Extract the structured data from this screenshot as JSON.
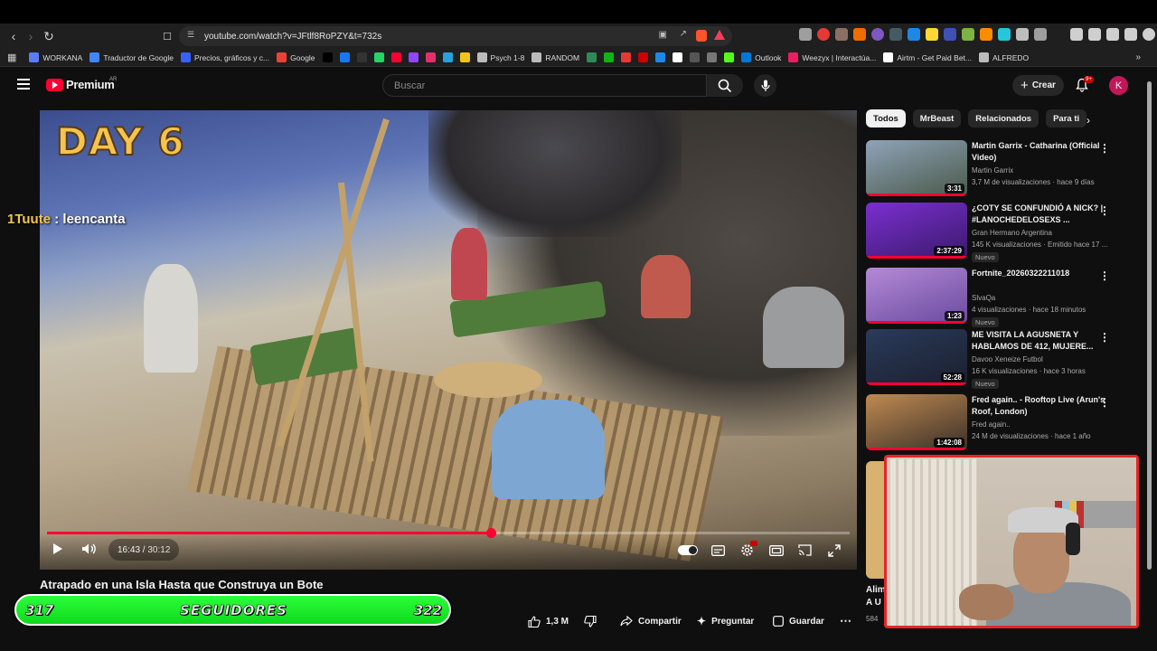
{
  "browser": {
    "url": "youtube.com/watch?v=JFtlf8RoPZY&t=732s",
    "bookmarks": [
      {
        "label": "WORKANA",
        "color": "#5b7cf5"
      },
      {
        "label": "Traductor de Google",
        "color": "#4285f4"
      },
      {
        "label": "Precios, gráficos y c...",
        "color": "#3861fb"
      },
      {
        "label": "Google",
        "color": "#ea4335"
      },
      {
        "label": "",
        "color": "#000000"
      },
      {
        "label": "",
        "color": "#1877f2"
      },
      {
        "label": "",
        "color": "#333333"
      },
      {
        "label": "",
        "color": "#25d366"
      },
      {
        "label": "",
        "color": "#ff0033"
      },
      {
        "label": "",
        "color": "#9146ff"
      },
      {
        "label": "",
        "color": "#e1306c"
      },
      {
        "label": "",
        "color": "#2aa1d8"
      },
      {
        "label": "",
        "color": "#f0c419"
      },
      {
        "label": "Psych 1-8",
        "color": "#bbbbbb"
      },
      {
        "label": "RANDOM",
        "color": "#bbbbbb"
      },
      {
        "label": "",
        "color": "#2e8b57"
      },
      {
        "label": "",
        "color": "#12b312"
      },
      {
        "label": "",
        "color": "#e53935"
      },
      {
        "label": "",
        "color": "#cc0000"
      },
      {
        "label": "",
        "color": "#1e88e5"
      },
      {
        "label": "",
        "color": "#ffffff"
      },
      {
        "label": "",
        "color": "#555555"
      },
      {
        "label": "",
        "color": "#777777"
      },
      {
        "label": "",
        "color": "#53fc18"
      },
      {
        "label": "Outlook",
        "color": "#0078d4"
      },
      {
        "label": "Weezyx | Interactúa...",
        "color": "#e91e63"
      },
      {
        "label": "Airtm - Get Paid Bet...",
        "color": "#ffffff"
      },
      {
        "label": "ALFREDO",
        "color": "#bbbbbb"
      }
    ]
  },
  "header": {
    "logo_text": "Premium",
    "country": "AR",
    "search_placeholder": "Buscar",
    "create_label": "Crear",
    "notif_count": "9+",
    "avatar_letter": "K"
  },
  "player": {
    "day_overlay": "DAY 6",
    "chat_user": "1Tuute",
    "chat_sep": " : ",
    "chat_message": "leencanta",
    "current_time": "16:43",
    "time_sep": " / ",
    "duration": "30:12",
    "progress": 0.553
  },
  "video": {
    "title": "Atrapado en una Isla Hasta que Construya un Bote",
    "likes": "1,3 M",
    "share_label": "Compartir",
    "ask_label": "Preguntar",
    "save_label": "Guardar"
  },
  "followers": {
    "current": "317",
    "label": "SEGUIDORES",
    "goal": "322"
  },
  "chips": [
    "Todos",
    "MrBeast",
    "Relacionados",
    "Para ti"
  ],
  "recommendations": [
    {
      "title": "Martin Garrix - Catharina (Official Video)",
      "channel": "Martin Garrix",
      "meta": "3,7 M de visualizaciones · hace 9 días",
      "duration": "3:31",
      "new": "",
      "colors": [
        "#8fa3b8",
        "#4a5a4a"
      ]
    },
    {
      "title": "¿COTY SE CONFUNDIÓ A NICK? | #LANOCHEDELOSEXS ...",
      "channel": "Gran Hermano Argentina",
      "meta": "145 K visualizaciones · Emitido hace 17 ...",
      "duration": "2:37:29",
      "new": "Nuevo",
      "colors": [
        "#7b2fd0",
        "#3a1a6b"
      ]
    },
    {
      "title": "Fortnite_20260322211018",
      "channel": "SlvaQa",
      "meta": "4 visualizaciones · hace 18 minutos",
      "duration": "1:23",
      "new": "Nuevo",
      "colors": [
        "#b48ad6",
        "#6a4aa0"
      ]
    },
    {
      "title": "ME VISITA LA AGUSNETA Y HABLAMOS DE 412, MUJERE...",
      "channel": "Davoo Xeneize Futbol",
      "meta": "16 K visualizaciones · hace 3 horas",
      "duration": "52:28",
      "new": "Nuevo",
      "colors": [
        "#2a3b5a",
        "#1b1f2e"
      ]
    },
    {
      "title": "Fred again.. - Rooftop Live (Arun's Roof, London)",
      "channel": "Fred again..",
      "meta": "24 M de visualizaciones · hace 1 año",
      "duration": "1:42:08",
      "new": "",
      "colors": [
        "#c08a52",
        "#3a3028"
      ]
    }
  ],
  "partial_rec": {
    "title_line1": "Alim",
    "title_line2": "A U",
    "meta": "584"
  }
}
